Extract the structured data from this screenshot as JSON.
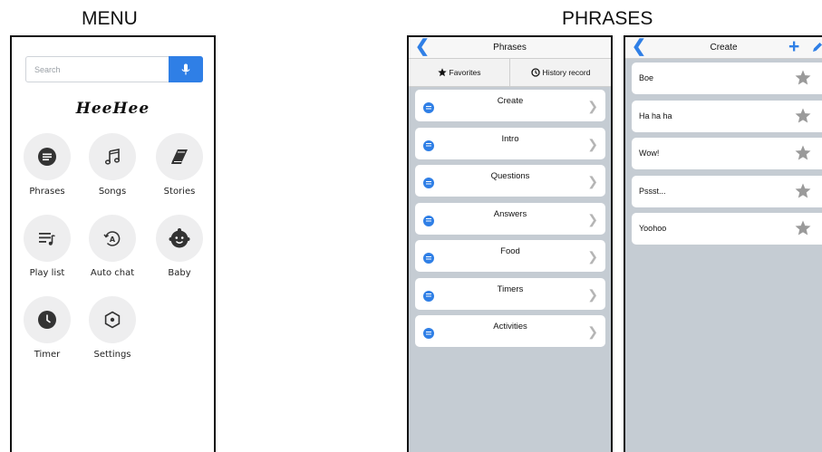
{
  "sections": {
    "menu": "MENU",
    "phrases": "PHRASES"
  },
  "menu": {
    "search": {
      "placeholder": "Search"
    },
    "app_title": "HeeHee",
    "tiles": [
      {
        "label": "Phrases",
        "icon": "phrases-icon"
      },
      {
        "label": "Songs",
        "icon": "music-note-icon"
      },
      {
        "label": "Stories",
        "icon": "book-icon"
      },
      {
        "label": "Play list",
        "icon": "playlist-icon"
      },
      {
        "label": "Auto chat",
        "icon": "auto-chat-icon"
      },
      {
        "label": "Baby",
        "icon": "baby-icon"
      },
      {
        "label": "Timer",
        "icon": "clock-icon"
      },
      {
        "label": "Settings",
        "icon": "settings-icon"
      }
    ]
  },
  "phrases": {
    "title": "Phrases",
    "tabs": [
      {
        "label": "Favorites",
        "icon": "star-icon"
      },
      {
        "label": "History record",
        "icon": "history-icon"
      }
    ],
    "categories": [
      "Create",
      "Intro",
      "Questions",
      "Answers",
      "Food",
      "Timers",
      "Activities"
    ]
  },
  "create": {
    "title": "Create",
    "items": [
      "Boe",
      "Ha ha ha",
      "Wow!",
      "Pssst...",
      "Yoohoo"
    ]
  },
  "colors": {
    "accent": "#2f7fe6",
    "list_bg": "#c5ccd3",
    "tile_bg": "#eeeeef"
  }
}
